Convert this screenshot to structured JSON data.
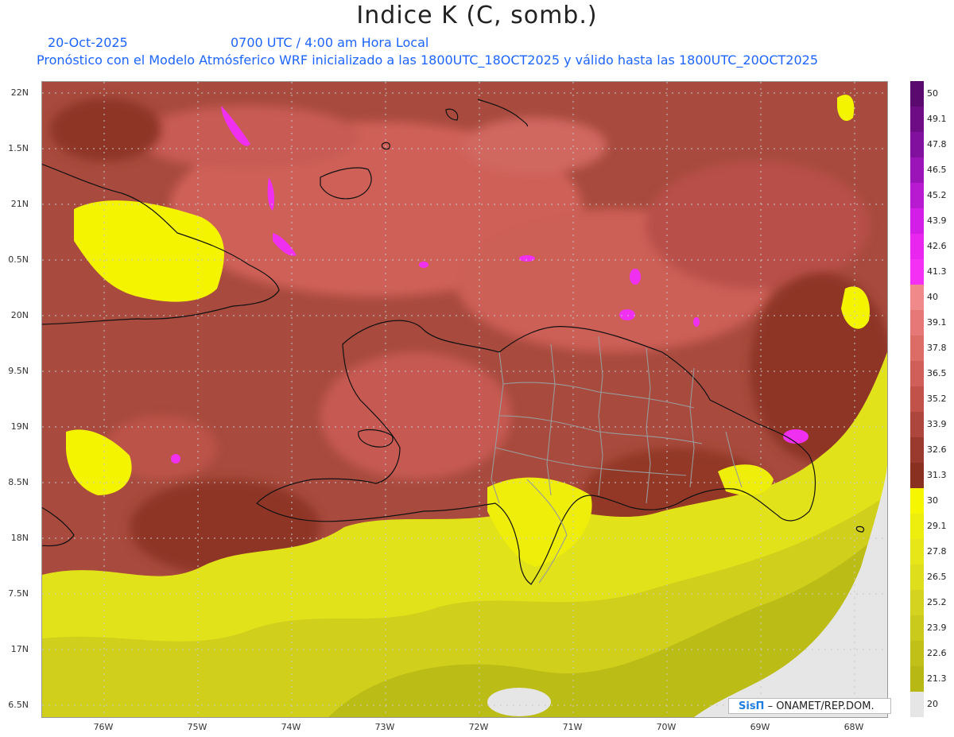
{
  "title": "Indice K (C, somb.)",
  "date": "20-Oct-2025",
  "valid_time": "0700 UTC / 4:00 am Hora Local",
  "description": "Pronóstico con el Modelo Atmósferico WRF inicializado a las 1800UTC_18OCT2025 y válido hasta las  1800UTC_20OCT2025",
  "lat_labels": [
    "22N",
    "1.5N",
    "21N",
    "0.5N",
    "20N",
    "9.5N",
    "19N",
    "8.5N",
    "18N",
    "7.5N",
    "17N",
    "6.5N"
  ],
  "lon_labels": [
    "76W",
    "75W",
    "74W",
    "73W",
    "72W",
    "71W",
    "70W",
    "69W",
    "68W"
  ],
  "colorbar": [
    {
      "label": "50",
      "color": "#5a0a6e"
    },
    {
      "label": "49.1",
      "color": "#6e0c86"
    },
    {
      "label": "47.8",
      "color": "#82109e"
    },
    {
      "label": "46.5",
      "color": "#9a14b8"
    },
    {
      "label": "45.2",
      "color": "#b81ad2"
    },
    {
      "label": "43.9",
      "color": "#d21ee6"
    },
    {
      "label": "42.6",
      "color": "#e826f0"
    },
    {
      "label": "41.3",
      "color": "#f430f4"
    },
    {
      "label": "40",
      "color": "#f08a8a"
    },
    {
      "label": "39.1",
      "color": "#e67878"
    },
    {
      "label": "37.8",
      "color": "#dc6c66"
    },
    {
      "label": "36.5",
      "color": "#cf5f58"
    },
    {
      "label": "35.2",
      "color": "#c0524a"
    },
    {
      "label": "33.9",
      "color": "#ad463c"
    },
    {
      "label": "32.6",
      "color": "#9a3a2e"
    },
    {
      "label": "31.3",
      "color": "#8a3020"
    },
    {
      "label": "30",
      "color": "#f6f600"
    },
    {
      "label": "29.1",
      "color": "#eeee0e"
    },
    {
      "label": "27.8",
      "color": "#e6e618"
    },
    {
      "label": "26.5",
      "color": "#dede1c"
    },
    {
      "label": "25.2",
      "color": "#d4d420"
    },
    {
      "label": "23.9",
      "color": "#caca1c"
    },
    {
      "label": "22.6",
      "color": "#c0c018"
    },
    {
      "label": "21.3",
      "color": "#b8b814"
    },
    {
      "label": "20",
      "color": "#e6e6e6"
    }
  ],
  "credit": {
    "logo": "SisΠ",
    "text": " – ONAMET/REP.DOM."
  }
}
